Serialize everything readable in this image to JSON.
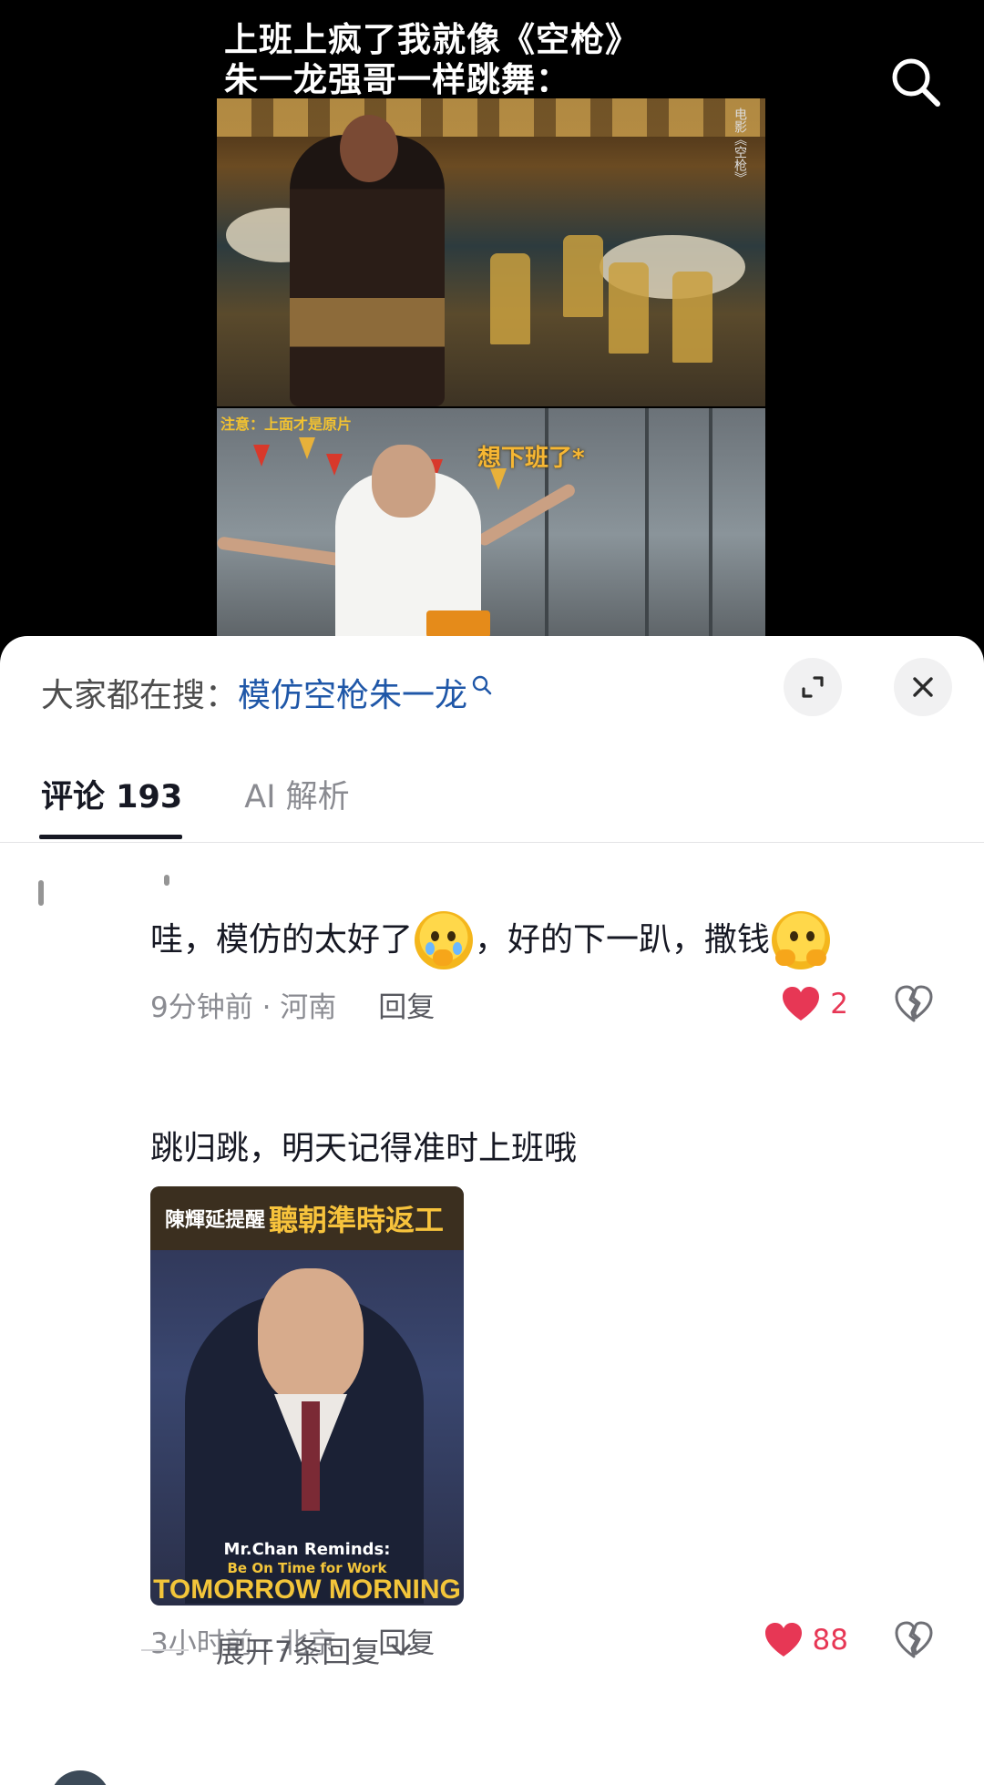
{
  "video": {
    "caption_line1": "上班上疯了我就像《空枪》",
    "caption_line2": "朱一龙强哥一样跳舞：",
    "still_top_watermark": "电影《空枪》",
    "still_bottom_note": "注意：上面才是原片",
    "still_bottom_bubble": "想下班了*"
  },
  "search": {
    "prefix": "大家都在搜：",
    "term": "模仿空枪朱一龙"
  },
  "tabs": [
    {
      "label": "评论 193",
      "active": true
    },
    {
      "label": "AI 解析",
      "active": false
    }
  ],
  "comments": [
    {
      "text_before": "哇，模仿的太好了",
      "text_middle": "，好的下一趴，撒钱",
      "time": "9分钟前 · 河南",
      "reply": "回复",
      "likes": "2"
    },
    {
      "text": "跳归跳，明天记得准时上班哦",
      "image": {
        "banner": "陳輝延提醒",
        "banner_highlight": "聽朝準時返工",
        "line1": "Mr.Chan Reminds:",
        "line2": "Be On Time for Work",
        "line3": "TOMORROW MORNING"
      },
      "time": "3小时前 · 北京",
      "reply": "回复",
      "likes": "88"
    }
  ],
  "expand_replies": "展开7条回复",
  "colors": {
    "like_red": "#e73755",
    "search_link": "#1f57a8",
    "panel_bg": "#ffffff"
  }
}
